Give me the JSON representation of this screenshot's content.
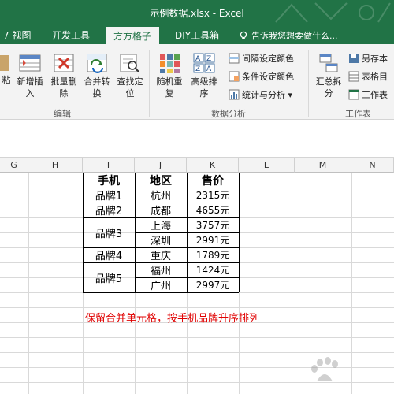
{
  "window": {
    "title": "示例数据.xlsx - Excel"
  },
  "tabs": [
    {
      "label": "7 视图"
    },
    {
      "label": "开发工具"
    },
    {
      "label": "方方格子"
    },
    {
      "label": "DIY工具箱"
    }
  ],
  "active_tab": "方方格子",
  "tell_me": "告诉我您想要做什么...",
  "ribbon": {
    "paste_partial": "粘",
    "insert_label": "新增插",
    "insert_label2": "入",
    "batch_delete": "批量删",
    "batch_delete2": "除",
    "merge_convert": "合并转",
    "merge_convert2": "换",
    "find_locate": "查找定",
    "find_locate2": "位",
    "group_edit": "编辑",
    "random_sort": "随机重",
    "random_sort2": "复",
    "advanced_sort": "高级排",
    "advanced_sort2": "序",
    "interval_color": "间隔设定颜色",
    "condition_color": "条件设定颜色",
    "stats_analysis": "统计与分析",
    "group_analysis": "数据分析",
    "summary_split": "汇总拆",
    "summary_split2": "分",
    "save_as": "另存本",
    "table_dir": "表格目",
    "worksheet": "工作表",
    "group_sheet": "工作表"
  },
  "columns": [
    "G",
    "H",
    "I",
    "J",
    "K",
    "L",
    "M",
    "N"
  ],
  "table": {
    "headers": [
      "手机",
      "地区",
      "售价"
    ],
    "brands": [
      "品牌1",
      "品牌2",
      "品牌3",
      "品牌4",
      "品牌5"
    ],
    "regions": [
      "杭州",
      "成都",
      "上海",
      "深圳",
      "重庆",
      "福州",
      "广州"
    ],
    "prices": [
      "2315元",
      "4655元",
      "3757元",
      "2991元",
      "1789元",
      "1424元",
      "2997元"
    ]
  },
  "note": "保留合并单元格，按手机品牌升序排列",
  "colors": {
    "excel_green": "#217346",
    "note_red": "#e00000"
  }
}
